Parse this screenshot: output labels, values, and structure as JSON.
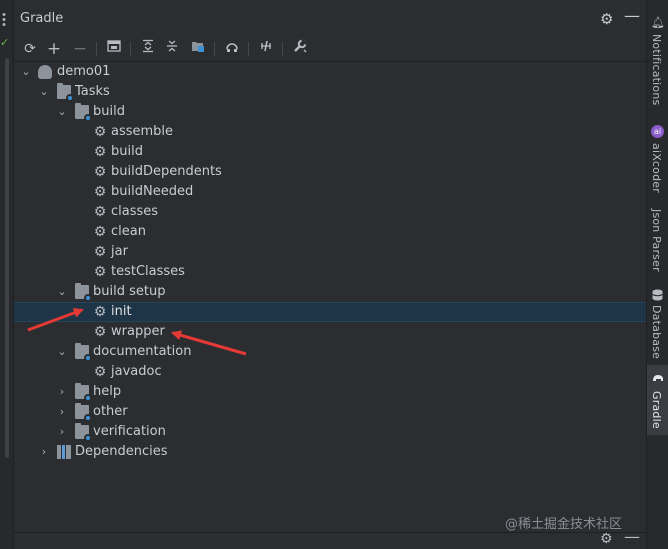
{
  "panel": {
    "title": "Gradle"
  },
  "toolbar": {
    "icons": [
      "refresh-icon",
      "plus-icon",
      "minus-icon",
      "toggle-offline-icon",
      "expand-all-icon",
      "collapse-all-icon",
      "group-icon",
      "execute-icon",
      "toggle-tests-icon",
      "settings-wrench-icon"
    ]
  },
  "tree": {
    "root": "demo01",
    "tasks": "Tasks",
    "build_group": "build",
    "build_tasks": [
      "assemble",
      "build",
      "buildDependents",
      "buildNeeded",
      "classes",
      "clean",
      "jar",
      "testClasses"
    ],
    "build_setup_group": "build setup",
    "build_setup_tasks": [
      "init",
      "wrapper"
    ],
    "documentation_group": "documentation",
    "documentation_tasks": [
      "javadoc"
    ],
    "help": "help",
    "other": "other",
    "verification": "verification",
    "dependencies": "Dependencies",
    "selected": "init"
  },
  "right_tabs": [
    "Notifications",
    "aiXcoder",
    "Json Parser",
    "Database",
    "Gradle"
  ],
  "right_active": "Gradle",
  "watermark": "@稀土掘金技术社区",
  "colors": {
    "selection": "#1e3447",
    "arrow": "#e53935",
    "accent": "#3d8fd6"
  }
}
